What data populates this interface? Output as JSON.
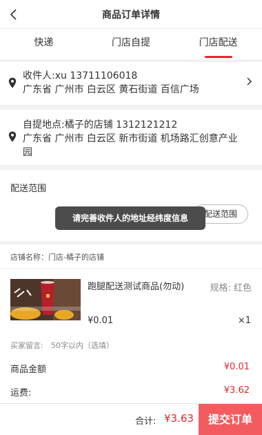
{
  "header": {
    "title": "商品订单详情"
  },
  "tabs": [
    {
      "label": "快递"
    },
    {
      "label": "门店自提"
    },
    {
      "label": "门店配送"
    }
  ],
  "recipient": {
    "line": "收件人:xu 13711106018",
    "address": "广东省 广州市 白云区 黄石街道 百信广场"
  },
  "pickup": {
    "line": "自提地点:橘子的店铺 1312121212",
    "address_line1": "广东省 广州市 白云区 新市街道 机场路汇创意产业",
    "address_line2": "园"
  },
  "delivery_range": {
    "title": "配送范围",
    "button": "配送范围",
    "toast": "请完善收件人的地址经纬度信息"
  },
  "store": {
    "name": "店铺名称：门店-橘子的店铺"
  },
  "goods": {
    "name": "跑腿配送测试商品(勿动)",
    "spec": "规格: 红色",
    "price": "¥0.01",
    "qty": "×1"
  },
  "message": {
    "label": "买家留言:",
    "hint": "50字以内（选填）"
  },
  "summary": {
    "amount_label": "商品金额",
    "amount_value": "¥0.01",
    "shipping_label": "运费:",
    "shipping_value": "¥3.62"
  },
  "footer": {
    "total_label": "合计:",
    "total_value": "¥3.63",
    "submit_label": "提交订单"
  },
  "colors": {
    "accent": "#e8242f",
    "submit_bg": "#f25c5f",
    "toast_bg": "#4c4c4c"
  },
  "icons": [
    "chevron-left-icon",
    "location-pin-icon",
    "chevron-right-icon"
  ]
}
